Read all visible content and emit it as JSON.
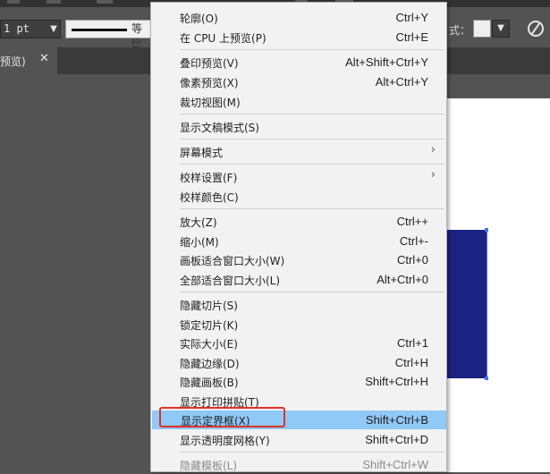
{
  "control_bar": {
    "stroke_weight": "1 pt",
    "stroke_profile": "等比",
    "style_label": "式：",
    "globe_icon": "globe-icon"
  },
  "tab": {
    "title": "预览)",
    "close_glyph": "✕"
  },
  "menu": {
    "items": [
      {
        "label": "轮廓(O)",
        "shortcut": "Ctrl+Y"
      },
      {
        "label": "在 CPU 上预览(P)",
        "shortcut": "Ctrl+E"
      },
      {
        "label": "叠印预览(V)",
        "shortcut": "Alt+Shift+Ctrl+Y"
      },
      {
        "label": "像素预览(X)",
        "shortcut": "Alt+Ctrl+Y"
      },
      {
        "label": "裁切视图(M)",
        "shortcut": ""
      },
      {
        "label": "显示文稿模式(S)",
        "shortcut": ""
      },
      {
        "label": "屏幕模式",
        "shortcut": "",
        "submenu": "›"
      },
      {
        "label": "校样设置(F)",
        "shortcut": "",
        "submenu": "›"
      },
      {
        "label": "校样颜色(C)",
        "shortcut": ""
      },
      {
        "label": "放大(Z)",
        "shortcut": "Ctrl++"
      },
      {
        "label": "缩小(M)",
        "shortcut": "Ctrl+-"
      },
      {
        "label": "画板适合窗口大小(W)",
        "shortcut": "Ctrl+0"
      },
      {
        "label": "全部适合窗口大小(L)",
        "shortcut": "Alt+Ctrl+0"
      },
      {
        "label": "隐藏切片(S)",
        "shortcut": ""
      },
      {
        "label": "锁定切片(K)",
        "shortcut": ""
      },
      {
        "label": "实际大小(E)",
        "shortcut": "Ctrl+1"
      },
      {
        "label": "隐藏边缘(D)",
        "shortcut": "Ctrl+H"
      },
      {
        "label": "隐藏画板(B)",
        "shortcut": "Shift+Ctrl+H"
      },
      {
        "label": "显示打印拼贴(T)",
        "shortcut": ""
      },
      {
        "label": "显示定界框(X)",
        "shortcut": "Shift+Ctrl+B",
        "highlighted": true
      },
      {
        "label": "显示透明度网格(Y)",
        "shortcut": "Shift+Ctrl+D"
      },
      {
        "label": "隐藏模板(L)",
        "shortcut": "Shift+Ctrl+W",
        "disabled": true
      }
    ]
  },
  "colors": {
    "highlight": "#90c8f6",
    "annotation_red": "#e0302a",
    "shape_fill": "#1c2282",
    "selection_blue": "#4a6ee8"
  }
}
